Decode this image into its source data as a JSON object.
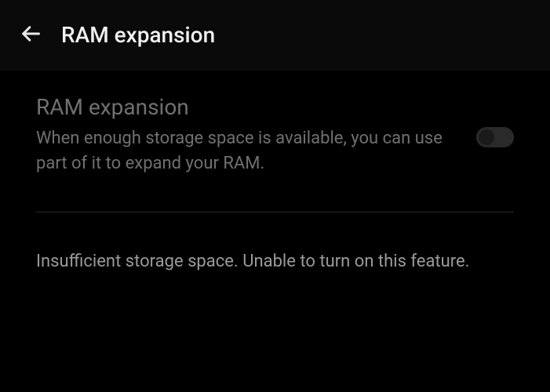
{
  "header": {
    "title": "RAM expansion"
  },
  "setting": {
    "title": "RAM expansion",
    "description": "When enough storage space is available, you can use part of it to expand your RAM.",
    "toggle_state": false
  },
  "status": {
    "message": "Insufficient storage space. Unable to turn on this feature."
  }
}
